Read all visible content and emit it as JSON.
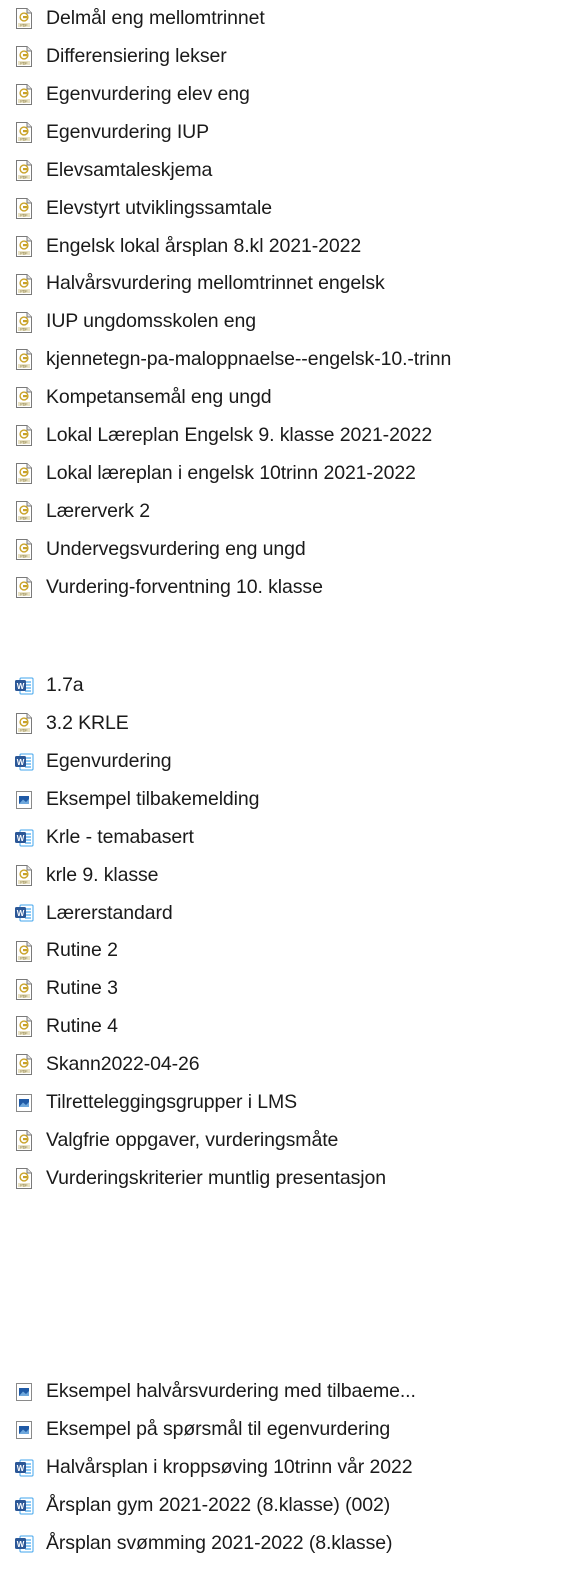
{
  "groups": [
    {
      "items": [
        {
          "name": "Delmål eng mellomtrinnet",
          "icon": "pdf-icon"
        },
        {
          "name": "Differensiering lekser",
          "icon": "pdf-icon"
        },
        {
          "name": "Egenvurdering elev eng",
          "icon": "pdf-icon"
        },
        {
          "name": "Egenvurdering IUP",
          "icon": "pdf-icon"
        },
        {
          "name": "Elevsamtaleskjema",
          "icon": "pdf-icon"
        },
        {
          "name": "Elevstyrt utviklingssamtale",
          "icon": "pdf-icon"
        },
        {
          "name": "Engelsk lokal årsplan 8.kl 2021-2022",
          "icon": "pdf-icon"
        },
        {
          "name": "Halvårsvurdering mellomtrinnet engelsk",
          "icon": "pdf-icon"
        },
        {
          "name": "IUP ungdomsskolen eng",
          "icon": "pdf-icon"
        },
        {
          "name": "kjennetegn-pa-maloppnaelse--engelsk-10.-trinn",
          "icon": "pdf-icon"
        },
        {
          "name": "Kompetansemål eng ungd",
          "icon": "pdf-icon"
        },
        {
          "name": "Lokal Læreplan Engelsk 9. klasse 2021-2022",
          "icon": "pdf-icon"
        },
        {
          "name": "Lokal læreplan i engelsk 10trinn 2021-2022",
          "icon": "pdf-icon"
        },
        {
          "name": "Lærerverk 2",
          "icon": "pdf-icon"
        },
        {
          "name": "Undervegsvurdering eng ungd",
          "icon": "pdf-icon"
        },
        {
          "name": "Vurdering-forventning 10. klasse",
          "icon": "pdf-icon"
        }
      ]
    },
    {
      "items": [
        {
          "name": "1.7a",
          "icon": "word-icon"
        },
        {
          "name": "3.2 KRLE",
          "icon": "pdf-icon"
        },
        {
          "name": "Egenvurdering",
          "icon": "word-icon"
        },
        {
          "name": "Eksempel tilbakemelding",
          "icon": "image-icon"
        },
        {
          "name": "Krle - temabasert",
          "icon": "word-icon"
        },
        {
          "name": "krle 9. klasse",
          "icon": "pdf-icon"
        },
        {
          "name": "Lærerstandard",
          "icon": "word-icon"
        },
        {
          "name": "Rutine 2",
          "icon": "pdf-icon"
        },
        {
          "name": "Rutine 3",
          "icon": "pdf-icon"
        },
        {
          "name": "Rutine 4",
          "icon": "pdf-icon"
        },
        {
          "name": "Skann2022-04-26",
          "icon": "pdf-icon"
        },
        {
          "name": "Tilretteleggingsgrupper i LMS",
          "icon": "image-icon"
        },
        {
          "name": "Valgfrie oppgaver, vurderingsmåte",
          "icon": "pdf-icon"
        },
        {
          "name": "Vurderingskriterier muntlig presentasjon",
          "icon": "pdf-icon"
        }
      ]
    },
    {
      "items": [
        {
          "name": "Eksempel halvårsvurdering med tilbaeme...",
          "icon": "image-icon"
        },
        {
          "name": "Eksempel på spørsmål til egenvurdering",
          "icon": "image-icon"
        },
        {
          "name": "Halvårsplan i kroppsøving 10trinn vår 2022",
          "icon": "word-icon"
        },
        {
          "name": "Årsplan gym 2021-2022 (8.klasse) (002)",
          "icon": "word-icon"
        },
        {
          "name": "Årsplan svømming 2021-2022 (8.klasse)",
          "icon": "word-icon"
        }
      ]
    }
  ],
  "colors": {
    "pdf_frame": "#7a7a7a",
    "pdf_accent": "#b8860b",
    "word_blue": "#2b5797",
    "image_blue": "#1f5aa6"
  }
}
